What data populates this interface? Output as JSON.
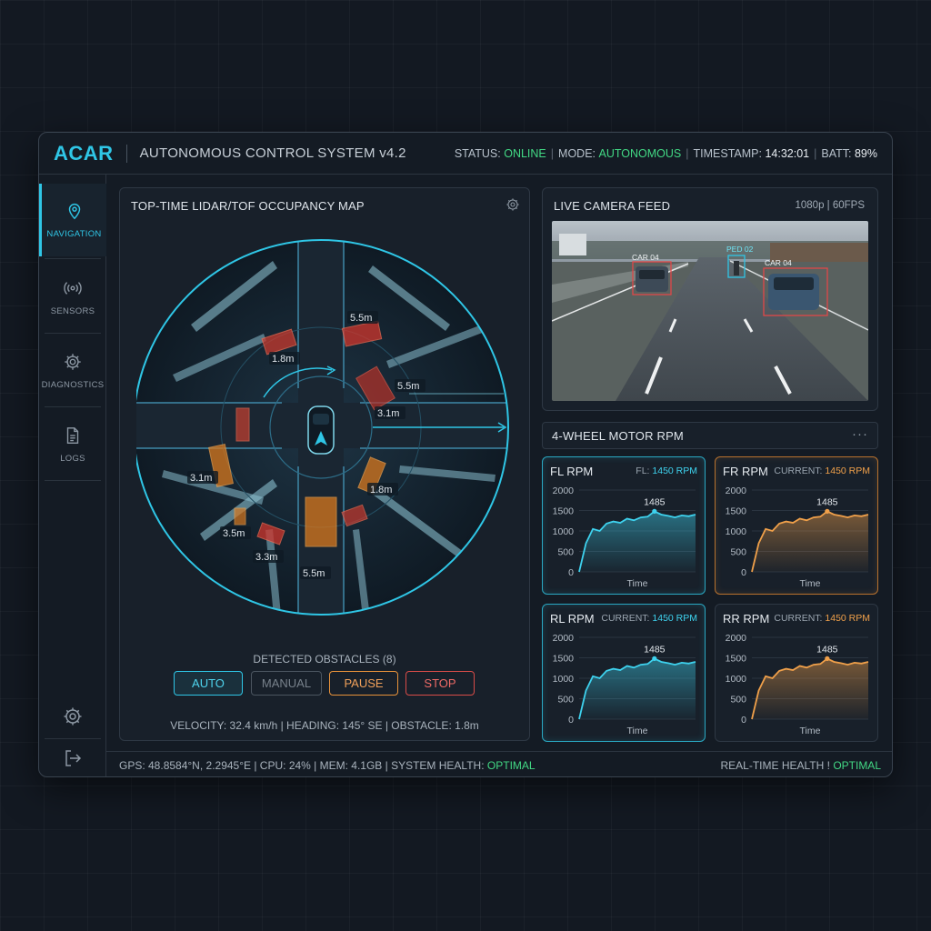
{
  "header": {
    "logo": "ACAR",
    "subtitle": "AUTONOMOUS CONTROL SYSTEM v4.2",
    "status_label": "STATUS:",
    "status_value": "ONLINE",
    "mode_label": "MODE:",
    "mode_value": "AUTONOMOUS",
    "timestamp_label": "TIMESTAMP:",
    "timestamp_value": "14:32:01",
    "batt_label": "BATT:",
    "batt_value": "89%"
  },
  "sidebar": {
    "items": [
      {
        "label": "NAVIGATION",
        "icon": "location-pin-icon",
        "active": true
      },
      {
        "label": "SENSORS",
        "icon": "signal-broadcast-icon"
      },
      {
        "label": "DIAGNOSTICS",
        "icon": "gear-icon"
      },
      {
        "label": "LOGS",
        "icon": "document-icon"
      }
    ],
    "bottom_icons": [
      "settings-gear-icon",
      "logout-icon"
    ]
  },
  "map": {
    "title": "TOP-TIME LIDAR/TOF OCCUPANCY MAP",
    "distances": [
      "5.5m",
      "1.8m",
      "5.5m",
      "3.1m",
      "3.1m",
      "1.8m",
      "3.5m",
      "3.3m",
      "5.5m"
    ],
    "detected_obstacles": "DETECTED OBSTACLES (8)",
    "controls": {
      "auto": "AUTO",
      "manual": "MANUAL",
      "pause": "PAUSE",
      "stop": "STOP"
    },
    "telemetry": "VELOCITY: 32.4 km/h | HEADING: 145° SE | OBSTACLE: 1.8m"
  },
  "camera": {
    "title": "LIVE CAMERA FEED",
    "resolution": "1080p | 60FPS",
    "detections": [
      "CAR 04",
      "PED 02",
      "CAR 04"
    ]
  },
  "rpm": {
    "title": "4-WHEEL MOTOR RPM",
    "cards": [
      {
        "title": "FL RPM",
        "current_label": "FL:",
        "current_value": "1450 RPM",
        "peak": "1485",
        "xlabel": "Time",
        "accent": "#3ed2ee"
      },
      {
        "title": "FR RPM",
        "current_label": "CURRENT:",
        "current_value": "1450 RPM",
        "peak": "1485",
        "xlabel": "Time",
        "accent": "#f0a04a"
      },
      {
        "title": "RL RPM",
        "current_label": "CURRENT:",
        "current_value": "1450 RPM",
        "peak": "1485",
        "xlabel": "Time",
        "accent": "#3ed2ee"
      },
      {
        "title": "RR RPM",
        "current_label": "CURRENT:",
        "current_value": "1450 RPM",
        "peak": "1485",
        "xlabel": "Time",
        "accent": "#f0a04a"
      }
    ],
    "yticks": [
      "2000",
      "1500",
      "1000",
      "500",
      "0"
    ],
    "series_values": [
      0,
      700,
      1050,
      1000,
      1180,
      1230,
      1200,
      1300,
      1260,
      1330,
      1350,
      1480,
      1400,
      1370,
      1330,
      1380,
      1360,
      1400
    ]
  },
  "footer": {
    "left_text": "GPS: 48.8584°N, 2.2945°E | CPU: 24% | MEM: 4.1GB | SYSTEM HEALTH:",
    "health_value": "OPTIMAL",
    "right_label": "REAL-TIME HEALTH !",
    "right_value": "OPTIMAL"
  },
  "colors": {
    "accent_cyan": "#2fc6e6",
    "status_green": "#42d884",
    "warning_orange": "#e8923a",
    "alert_red": "#d84c48"
  }
}
